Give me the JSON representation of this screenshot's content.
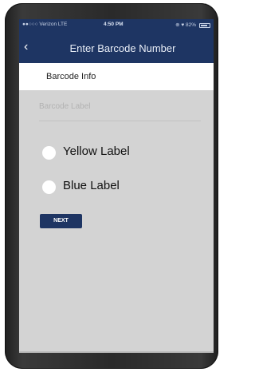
{
  "status_bar": {
    "carrier": "●●○○○ Verizon  LTE",
    "time": "4:50 PM",
    "right_indicators": "⊕ ♥ 82%",
    "battery_level": 0.82
  },
  "header": {
    "back_icon": "chevron-left-icon",
    "title": "Enter Barcode Number"
  },
  "section": {
    "label": "Barcode Info"
  },
  "form": {
    "barcode_label_placeholder": "Barcode Label",
    "options": [
      {
        "label": "Yellow Label"
      },
      {
        "label": "Blue Label"
      }
    ],
    "next_label": "NEXT"
  },
  "colors": {
    "header_bg": "#1e3563",
    "screen_bg": "#d3d3d3"
  }
}
